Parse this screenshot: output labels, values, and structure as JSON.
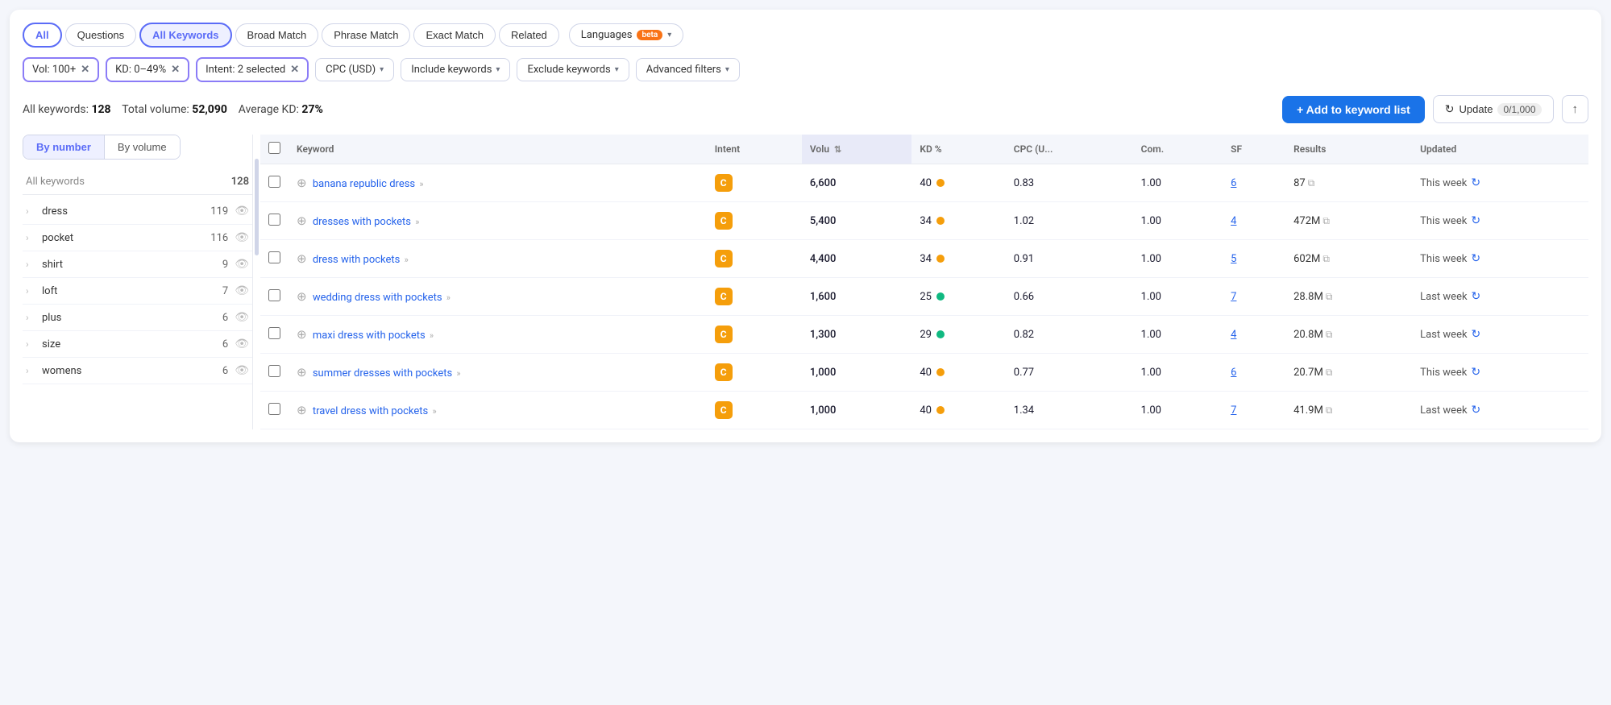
{
  "tabs": {
    "items": [
      {
        "id": "all",
        "label": "All",
        "active": true
      },
      {
        "id": "questions",
        "label": "Questions",
        "active": false
      },
      {
        "id": "all-keywords",
        "label": "All Keywords",
        "selected": true
      },
      {
        "id": "broad-match",
        "label": "Broad Match",
        "active": false
      },
      {
        "id": "phrase-match",
        "label": "Phrase Match",
        "active": false
      },
      {
        "id": "exact-match",
        "label": "Exact Match",
        "active": false
      },
      {
        "id": "related",
        "label": "Related",
        "active": false
      }
    ],
    "languages_label": "Languages",
    "beta_label": "beta"
  },
  "filters": {
    "chips": [
      {
        "id": "vol",
        "label": "Vol: 100+"
      },
      {
        "id": "kd",
        "label": "KD: 0–49%"
      },
      {
        "id": "intent",
        "label": "Intent: 2 selected"
      }
    ],
    "dropdowns": [
      {
        "id": "cpc",
        "label": "CPC (USD)"
      },
      {
        "id": "include",
        "label": "Include keywords"
      },
      {
        "id": "exclude",
        "label": "Exclude keywords"
      },
      {
        "id": "advanced",
        "label": "Advanced filters"
      }
    ]
  },
  "summary": {
    "all_keywords_label": "All keywords:",
    "all_keywords_count": "128",
    "total_volume_label": "Total volume:",
    "total_volume_value": "52,090",
    "avg_kd_label": "Average KD:",
    "avg_kd_value": "27%",
    "add_button_label": "+ Add to keyword list",
    "update_button_label": "Update",
    "update_count": "0/1,000",
    "export_icon": "↑"
  },
  "sidebar": {
    "controls": [
      {
        "id": "by-number",
        "label": "By number",
        "active": true
      },
      {
        "id": "by-volume",
        "label": "By volume",
        "active": false
      }
    ],
    "header": {
      "col1": "All keywords",
      "col2": "128"
    },
    "items": [
      {
        "label": "dress",
        "count": "119"
      },
      {
        "label": "pocket",
        "count": "116"
      },
      {
        "label": "shirt",
        "count": "9"
      },
      {
        "label": "loft",
        "count": "7"
      },
      {
        "label": "plus",
        "count": "6"
      },
      {
        "label": "size",
        "count": "6"
      },
      {
        "label": "womens",
        "count": "6"
      }
    ]
  },
  "table": {
    "columns": [
      {
        "id": "checkbox",
        "label": ""
      },
      {
        "id": "keyword",
        "label": "Keyword"
      },
      {
        "id": "intent",
        "label": "Intent"
      },
      {
        "id": "volume",
        "label": "Volu",
        "sorted": true
      },
      {
        "id": "kd",
        "label": "KD %"
      },
      {
        "id": "cpc",
        "label": "CPC (U..."
      },
      {
        "id": "com",
        "label": "Com."
      },
      {
        "id": "sf",
        "label": "SF"
      },
      {
        "id": "results",
        "label": "Results"
      },
      {
        "id": "updated",
        "label": "Updated"
      }
    ],
    "rows": [
      {
        "keyword": "banana republic dress",
        "intent": "C",
        "intent_color": "orange",
        "volume": "6,600",
        "kd": "40",
        "kd_color": "orange",
        "cpc": "0.83",
        "com": "1.00",
        "sf": "6",
        "results": "87",
        "updated": "This week"
      },
      {
        "keyword": "dresses with pockets",
        "intent": "C",
        "intent_color": "orange",
        "volume": "5,400",
        "kd": "34",
        "kd_color": "orange",
        "cpc": "1.02",
        "com": "1.00",
        "sf": "4",
        "results": "472M",
        "updated": "This week"
      },
      {
        "keyword": "dress with pockets",
        "intent": "C",
        "intent_color": "orange",
        "volume": "4,400",
        "kd": "34",
        "kd_color": "orange",
        "cpc": "0.91",
        "com": "1.00",
        "sf": "5",
        "results": "602M",
        "updated": "This week"
      },
      {
        "keyword": "wedding dress with pockets",
        "intent": "C",
        "intent_color": "orange",
        "volume": "1,600",
        "kd": "25",
        "kd_color": "green",
        "cpc": "0.66",
        "com": "1.00",
        "sf": "7",
        "results": "28.8M",
        "updated": "Last week"
      },
      {
        "keyword": "maxi dress with pockets",
        "intent": "C",
        "intent_color": "orange",
        "volume": "1,300",
        "kd": "29",
        "kd_color": "green",
        "cpc": "0.82",
        "com": "1.00",
        "sf": "4",
        "results": "20.8M",
        "updated": "Last week"
      },
      {
        "keyword": "summer dresses with pockets",
        "intent": "C",
        "intent_color": "orange",
        "volume": "1,000",
        "kd": "40",
        "kd_color": "orange",
        "cpc": "0.77",
        "com": "1.00",
        "sf": "6",
        "results": "20.7M",
        "updated": "This week"
      },
      {
        "keyword": "travel dress with pockets",
        "intent": "C",
        "intent_color": "orange",
        "volume": "1,000",
        "kd": "40",
        "kd_color": "orange",
        "cpc": "1.34",
        "com": "1.00",
        "sf": "7",
        "results": "41.9M",
        "updated": "Last week"
      }
    ]
  }
}
